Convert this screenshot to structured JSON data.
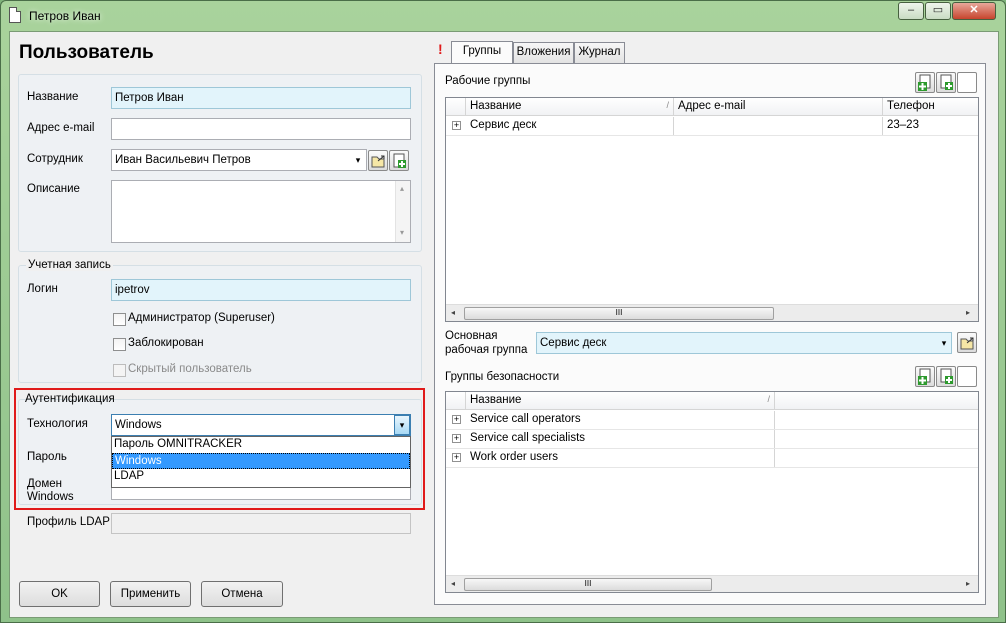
{
  "window": {
    "title": "Петров Иван",
    "controls": {
      "minimize": "–",
      "maximize": "▭",
      "close": "✕"
    }
  },
  "form": {
    "heading": "Пользователь",
    "name_label": "Название",
    "name_value": "Петров Иван",
    "email_label": "Адрес e-mail",
    "email_value": "",
    "employee_label": "Сотрудник",
    "employee_value": "Иван Васильевич Петров",
    "description_label": "Описание",
    "description_value": ""
  },
  "account": {
    "legend": "Учетная запись",
    "login_label": "Логин",
    "login_value": "ipetrov",
    "admin_label": "Администратор (Superuser)",
    "blocked_label": "Заблокирован",
    "hidden_label": "Скрытый пользователь"
  },
  "auth": {
    "legend": "Аутентификация",
    "technology_label": "Технология",
    "technology_value": "Windows",
    "password_label": "Пароль",
    "domain_label_1": "Домен",
    "domain_label_2": "Windows",
    "options": [
      "Пароль OMNITRACKER",
      "Windows",
      "LDAP"
    ],
    "selected_index": 1
  },
  "ldap": {
    "profile_label": "Профиль LDAP",
    "profile_value": ""
  },
  "buttons": {
    "ok": "OK",
    "apply": "Применить",
    "cancel": "Отмена"
  },
  "tabs": {
    "marker": "!",
    "items": [
      "Группы",
      "Вложения",
      "Журнал"
    ],
    "active": 0
  },
  "workgroups": {
    "label": "Рабочие группы",
    "columns": [
      "Название",
      "Адрес e-mail",
      "Телефон"
    ],
    "rows": [
      {
        "name": "Сервис деск",
        "email": "",
        "phone": "23–23"
      }
    ]
  },
  "main_group": {
    "label_1": "Основная",
    "label_2": "рабочая группа",
    "value": "Сервис деск"
  },
  "security": {
    "label": "Группы безопасности",
    "columns": [
      "Название"
    ],
    "rows": [
      "Service call operators",
      "Service call specialists",
      "Work order users"
    ]
  },
  "scroll": {
    "grip": "III",
    "left": "◂",
    "right": "▸",
    "up": "▴",
    "down": "▾"
  },
  "icons": {
    "dropdown": "▾",
    "expand": "+",
    "sort": "/"
  },
  "colors": {
    "highlight": "#e01a1a",
    "selection": "#3399ff",
    "required_field": "#e2f4fb"
  }
}
